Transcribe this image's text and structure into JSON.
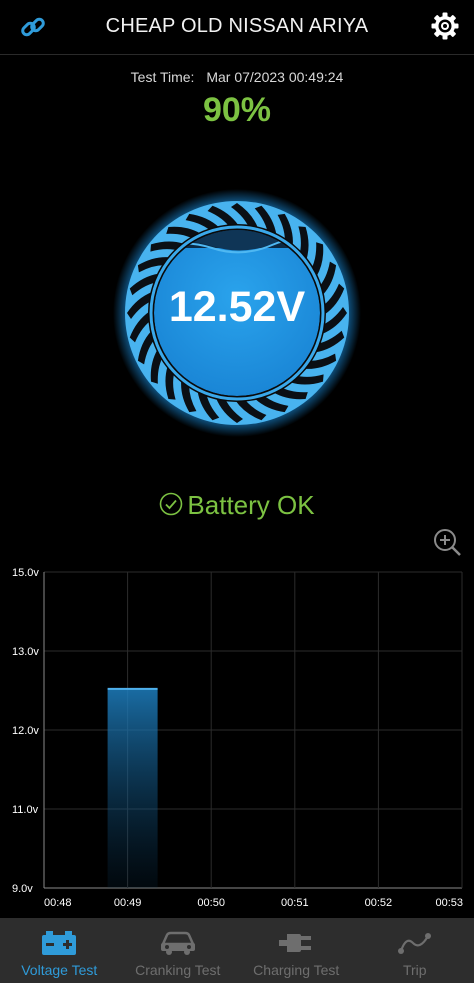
{
  "header": {
    "title": "CHEAP OLD NISSAN ARIYA",
    "link_icon": "link-icon",
    "settings_icon": "gear-icon"
  },
  "test": {
    "time_label": "Test Time:",
    "time_value": "Mar 07/2023 00:49:24",
    "percent": "90%"
  },
  "gauge": {
    "voltage": "12.52V",
    "accent": "#2f9bd9"
  },
  "status": {
    "text": "Battery OK",
    "color": "#7cc242"
  },
  "chart_data": {
    "type": "bar",
    "ylim": [
      9.0,
      15.0
    ],
    "y_ticks": [
      "15.0v",
      "13.0v",
      "12.0v",
      "11.0v",
      "9.0v"
    ],
    "x_ticks": [
      "00:48",
      "00:49",
      "00:50",
      "00:51",
      "00:52",
      "00:53"
    ],
    "bars": [
      {
        "x": "00:49",
        "value": 12.52
      }
    ]
  },
  "nav": {
    "items": [
      {
        "label": "Voltage Test",
        "icon": "battery-icon",
        "active": true
      },
      {
        "label": "Cranking Test",
        "icon": "car-icon",
        "active": false
      },
      {
        "label": "Charging Test",
        "icon": "plug-icon",
        "active": false
      },
      {
        "label": "Trip",
        "icon": "route-icon",
        "active": false
      }
    ]
  }
}
